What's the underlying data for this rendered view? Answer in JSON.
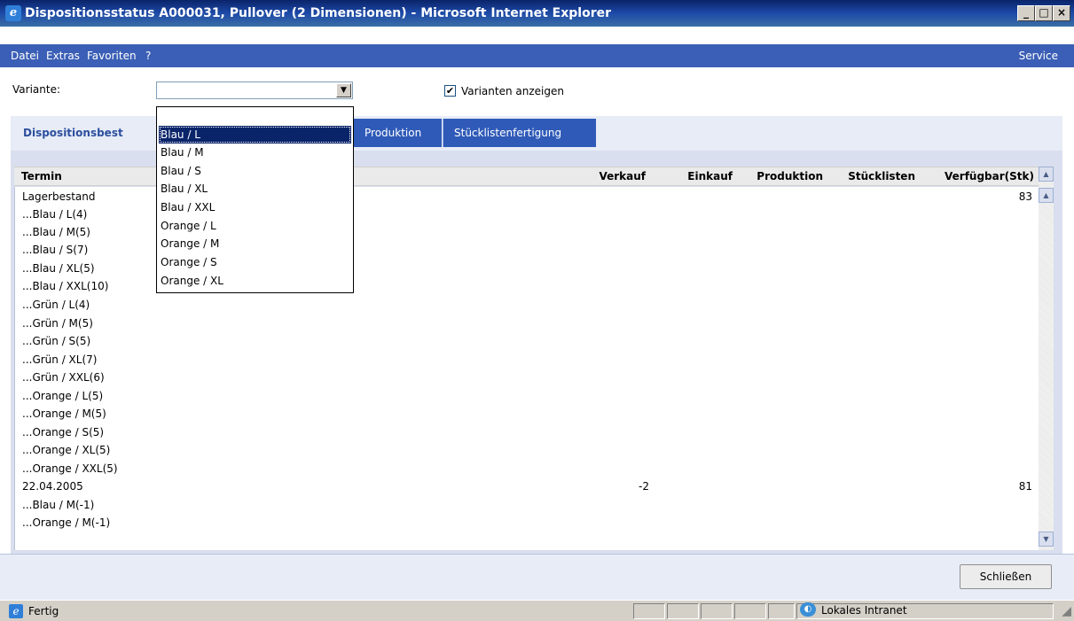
{
  "window": {
    "title": "Dispositionsstatus A000031, Pullover (2 Dimensionen) - Microsoft Internet Explorer",
    "minimize": "_",
    "maximize": "□",
    "close": "×"
  },
  "menu": {
    "items": [
      {
        "label": "Datei"
      },
      {
        "label": "Extras"
      },
      {
        "label": "Favoriten"
      },
      {
        "label": "?"
      }
    ],
    "service": "Service"
  },
  "filters": {
    "variant_label": "Variante:",
    "variant_value": "",
    "show_variants_label": "Varianten anzeigen",
    "show_variants_checked": true
  },
  "tabs": [
    {
      "label": "Dispositionsbest",
      "active": true
    },
    {
      "label": "Produktion"
    },
    {
      "label": "Stücklistenfertigung"
    }
  ],
  "dropdown": {
    "options": [
      "",
      "Blau / L",
      "Blau / M",
      "Blau / S",
      "Blau / XL",
      "Blau / XXL",
      "Orange / L",
      "Orange / M",
      "Orange / S",
      "Orange / XL"
    ],
    "selected": "Blau / L"
  },
  "grid": {
    "columns": [
      "Termin",
      "Verkauf",
      "Einkauf",
      "Produktion",
      "Stücklisten",
      "Verfügbar(Stk)"
    ],
    "rows": [
      {
        "termin": "Lagerbestand",
        "verkauf": "",
        "verfuegbar": "83"
      },
      {
        "termin": "...Blau / L(4)",
        "verkauf": "",
        "verfuegbar": ""
      },
      {
        "termin": "...Blau / M(5)",
        "verkauf": "",
        "verfuegbar": ""
      },
      {
        "termin": "...Blau / S(7)",
        "verkauf": "",
        "verfuegbar": ""
      },
      {
        "termin": "...Blau / XL(5)",
        "verkauf": "",
        "verfuegbar": ""
      },
      {
        "termin": "...Blau / XXL(10)",
        "verkauf": "",
        "verfuegbar": ""
      },
      {
        "termin": "...Grün / L(4)",
        "verkauf": "",
        "verfuegbar": ""
      },
      {
        "termin": "...Grün / M(5)",
        "verkauf": "",
        "verfuegbar": ""
      },
      {
        "termin": "...Grün / S(5)",
        "verkauf": "",
        "verfuegbar": ""
      },
      {
        "termin": "...Grün / XL(7)",
        "verkauf": "",
        "verfuegbar": ""
      },
      {
        "termin": "...Grün / XXL(6)",
        "verkauf": "",
        "verfuegbar": ""
      },
      {
        "termin": "...Orange / L(5)",
        "verkauf": "",
        "verfuegbar": ""
      },
      {
        "termin": "...Orange / M(5)",
        "verkauf": "",
        "verfuegbar": ""
      },
      {
        "termin": "...Orange / S(5)",
        "verkauf": "",
        "verfuegbar": ""
      },
      {
        "termin": "...Orange / XL(5)",
        "verkauf": "",
        "verfuegbar": ""
      },
      {
        "termin": "...Orange / XXL(5)",
        "verkauf": "",
        "verfuegbar": ""
      },
      {
        "termin": "22.04.2005",
        "verkauf": "-2",
        "verfuegbar": "81"
      },
      {
        "termin": "...Blau / M(-1)",
        "verkauf": "",
        "verfuegbar": ""
      },
      {
        "termin": "...Orange / M(-1)",
        "verkauf": "",
        "verfuegbar": ""
      }
    ]
  },
  "buttons": {
    "close": "Schließen"
  },
  "status": {
    "text": "Fertig",
    "zone": "Lokales Intranet"
  }
}
